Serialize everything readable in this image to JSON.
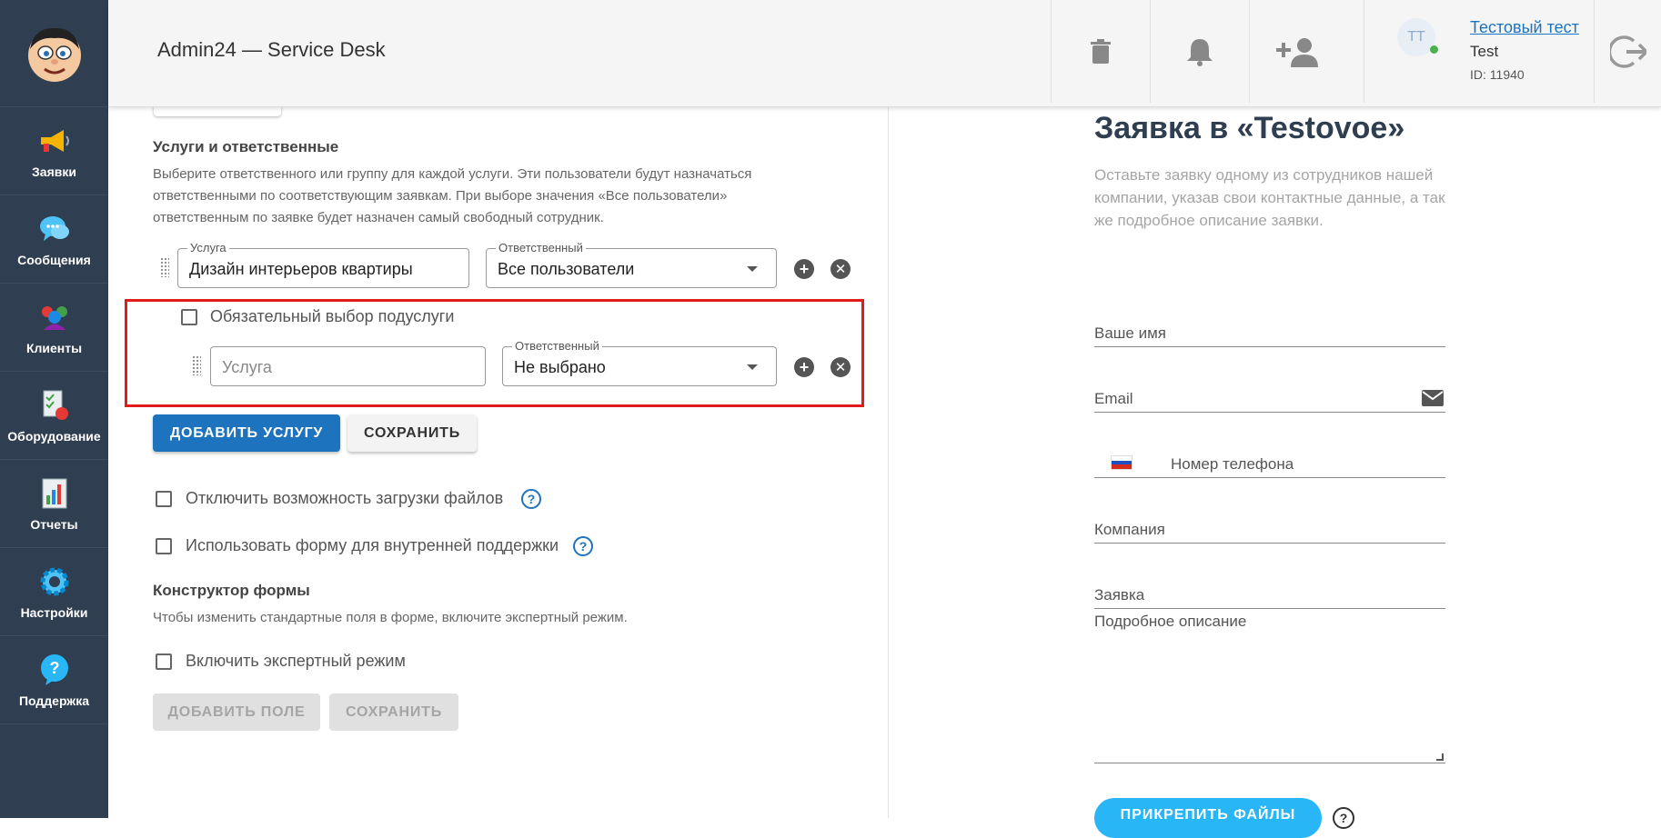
{
  "header": {
    "title": "Admin24 — Service Desk",
    "user": {
      "initials": "ТТ",
      "link": "Тестовый тест",
      "name": "Test",
      "id": "ID: 11940"
    }
  },
  "sidebar": {
    "items": [
      {
        "label": "Заявки",
        "icon": "megaphone-icon"
      },
      {
        "label": "Сообщения",
        "icon": "chat-bubble-icon"
      },
      {
        "label": "Клиенты",
        "icon": "clients-icon"
      },
      {
        "label": "Оборудование",
        "icon": "equipment-icon"
      },
      {
        "label": "Отчеты",
        "icon": "report-chart-icon"
      },
      {
        "label": "Настройки",
        "icon": "gear-icon"
      },
      {
        "label": "Поддержка",
        "icon": "help-bubble-icon"
      }
    ]
  },
  "services": {
    "title": "Услуги и ответственные",
    "description": "Выберите ответственного или группу для каждой услуги. Эти пользователи будут назначаться ответственными по соответствующим заявкам. При выборе значения «Все пользователи» ответственным по заявке будет назначен самый свободный сотрудник.",
    "row1": {
      "service_label": "Услуга",
      "service_value": "Дизайн интерьеров квартиры",
      "resp_label": "Ответственный",
      "resp_value": "Все пользователи"
    },
    "subservice_checkbox": "Обязательный выбор подуслуги",
    "row2": {
      "service_placeholder": "Услуга",
      "resp_label": "Ответственный",
      "resp_value": "Не выбрано"
    },
    "add_button": "ДОБАВИТЬ УСЛУГУ",
    "save_button": "СОХРАНИТЬ"
  },
  "options": {
    "disable_files": "Отключить возможность загрузки файлов",
    "internal_support": "Использовать форму для внутренней поддержки"
  },
  "constructor": {
    "title": "Конструктор формы",
    "description": "Чтобы изменить стандартные поля в форме, включите экспертный режим.",
    "expert_mode": "Включить экспертный режим",
    "add_field_button": "ДОБАВИТЬ ПОЛЕ",
    "save_button": "СОХРАНИТЬ"
  },
  "preview": {
    "title": "Заявка в «Testovoe»",
    "description": "Оставьте заявку одному из сотрудников нашей компании, указав свои контактные данные, а так же подробное описание заявки.",
    "fields": {
      "name": "Ваше имя",
      "email": "Email",
      "phone": "Номер телефона",
      "company": "Компания",
      "request": "Заявка",
      "details": "Подробное описание"
    },
    "attach_button": "ПРИКРЕПИТЬ ФАЙЛЫ",
    "help_mark": "?"
  },
  "colors": {
    "sidebar": "#2f3e50",
    "primary": "#1e73be",
    "highlight": "#e21b1b",
    "attach": "#29b6f6"
  }
}
